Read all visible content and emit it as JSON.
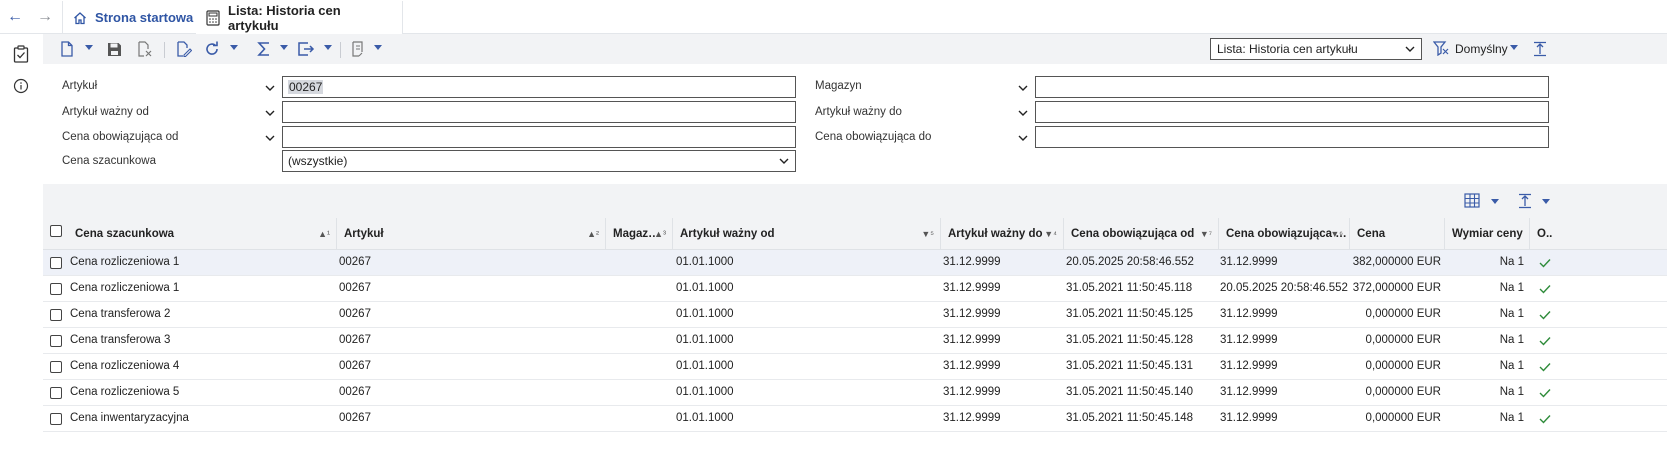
{
  "tabs": {
    "home_label": "Strona startowa",
    "list_label": "Lista: Historia cen artykułu"
  },
  "toolbar": {
    "view_selected": "Lista: Historia cen artykułu",
    "defaults_label": "Domyślny"
  },
  "filters": {
    "article_label": "Artykuł",
    "article_value": "00267",
    "warehouse_label": "Magazyn",
    "warehouse_value": "",
    "valid_from_label": "Artykuł ważny od",
    "valid_from_value": "",
    "valid_to_label": "Artykuł ważny do",
    "valid_to_value": "",
    "price_from_label": "Cena obowiązująca od",
    "price_from_value": "",
    "price_to_label": "Cena obowiązująca do",
    "price_to_value": "",
    "estimated_label": "Cena szacunkowa",
    "estimated_value": "(wszystkie)"
  },
  "table": {
    "columns": [
      "Cena szacunkowa",
      "Artykuł",
      "Magaz…",
      "Artykuł ważny od",
      "Artykuł ważny do",
      "Cena obowiązująca od",
      "Cena obowiązująca …",
      "Cena",
      "Wymiar ceny",
      "O.."
    ],
    "sort_markers": [
      "▲¹",
      "▲²",
      "▲³",
      "▼⁵",
      "▼⁴",
      "▼⁷",
      "▼⁶"
    ],
    "rows": [
      [
        "Cena rozliczeniowa 1",
        "00267",
        "",
        "01.01.1000",
        "31.12.9999",
        "20.05.2025 20:58:46.552",
        "31.12.9999",
        "382,000000 EUR",
        "Na 1"
      ],
      [
        "Cena rozliczeniowa 1",
        "00267",
        "",
        "01.01.1000",
        "31.12.9999",
        "31.05.2021 11:50:45.118",
        "20.05.2025 20:58:46.552",
        "372,000000 EUR",
        "Na 1"
      ],
      [
        "Cena transferowa 2",
        "00267",
        "",
        "01.01.1000",
        "31.12.9999",
        "31.05.2021 11:50:45.125",
        "31.12.9999",
        "0,000000 EUR",
        "Na 1"
      ],
      [
        "Cena transferowa 3",
        "00267",
        "",
        "01.01.1000",
        "31.12.9999",
        "31.05.2021 11:50:45.128",
        "31.12.9999",
        "0,000000 EUR",
        "Na 1"
      ],
      [
        "Cena rozliczeniowa 4",
        "00267",
        "",
        "01.01.1000",
        "31.12.9999",
        "31.05.2021 11:50:45.131",
        "31.12.9999",
        "0,000000 EUR",
        "Na 1"
      ],
      [
        "Cena rozliczeniowa 5",
        "00267",
        "",
        "01.01.1000",
        "31.12.9999",
        "31.05.2021 11:50:45.140",
        "31.12.9999",
        "0,000000 EUR",
        "Na 1"
      ],
      [
        "Cena inwentaryzacyjna",
        "00267",
        "",
        "01.01.1000",
        "31.12.9999",
        "31.05.2021 11:50:45.148",
        "31.12.9999",
        "0,000000 EUR",
        "Na 1"
      ]
    ]
  },
  "colors": {
    "accent": "#2f55a4",
    "check_green": "#2e8b3a",
    "panel_bg": "#f2f3f5"
  }
}
